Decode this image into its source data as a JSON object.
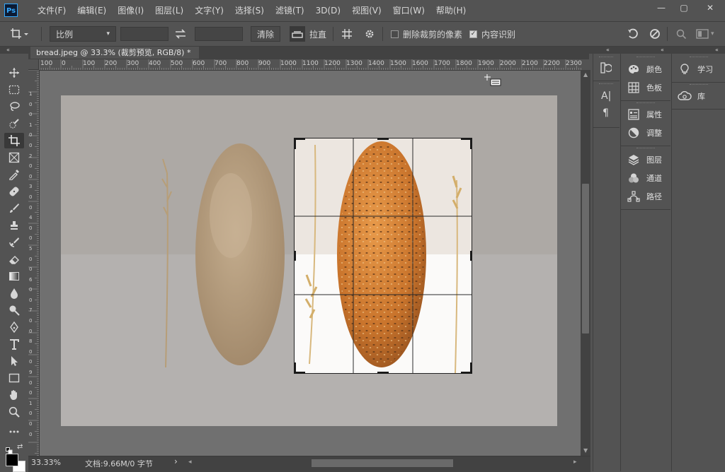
{
  "app": {
    "logo": "Ps"
  },
  "menu": [
    "文件(F)",
    "编辑(E)",
    "图像(I)",
    "图层(L)",
    "文字(Y)",
    "选择(S)",
    "滤镜(T)",
    "3D(D)",
    "视图(V)",
    "窗口(W)",
    "帮助(H)"
  ],
  "window_controls": {
    "minimize": "—",
    "restore": "▢",
    "close": "✕"
  },
  "options": {
    "ratio_select": "比例",
    "clear_button": "清除",
    "straighten_label": "拉直",
    "delete_cropped_label": "删除裁剪的像素",
    "delete_cropped_checked": false,
    "content_aware_label": "内容识别",
    "content_aware_checked": true
  },
  "document": {
    "tab_title": "bread.jpeg @ 33.3% (裁剪预览, RGB/8) *",
    "close_glyph": "×"
  },
  "ruler": {
    "h_ticks": [
      "100",
      "0",
      "100",
      "200",
      "300",
      "400",
      "500",
      "600",
      "700",
      "800",
      "900",
      "1000",
      "1100",
      "1200",
      "1300",
      "1400",
      "1500",
      "1600",
      "1700",
      "1800",
      "1900",
      "2000",
      "2100",
      "2200",
      "2300"
    ],
    "v_ticks": [
      "1",
      "0",
      "0",
      "1",
      "0",
      "0",
      "2",
      "0",
      "0",
      "3",
      "0",
      "0",
      "4",
      "0",
      "0",
      "5",
      "0",
      "0",
      "6",
      "0",
      "0",
      "7",
      "0",
      "0",
      "8",
      "0",
      "0",
      "9",
      "0",
      "0",
      "1",
      "0",
      "0",
      "0"
    ]
  },
  "status": {
    "zoom": "33.33%",
    "doc_info": "文档:9.66M/0 字节",
    "arrow": "›"
  },
  "panels": {
    "col2": [
      {
        "label": "颜色",
        "icon": "palette-icon"
      },
      {
        "label": "色板",
        "icon": "swatches-icon"
      },
      {
        "label": "属性",
        "icon": "properties-icon"
      },
      {
        "label": "调整",
        "icon": "adjustments-icon"
      },
      {
        "label": "图层",
        "icon": "layers-icon"
      },
      {
        "label": "通道",
        "icon": "channels-icon"
      },
      {
        "label": "路径",
        "icon": "paths-icon"
      }
    ],
    "col3": [
      {
        "label": "学习",
        "icon": "lightbulb-icon"
      },
      {
        "label": "库",
        "icon": "libraries-icon"
      }
    ],
    "collapse_glyph": "«"
  },
  "colors": {
    "ui": "#535353",
    "dark": "#424242",
    "canvas": "#707070",
    "accent": "#31a8ff"
  }
}
